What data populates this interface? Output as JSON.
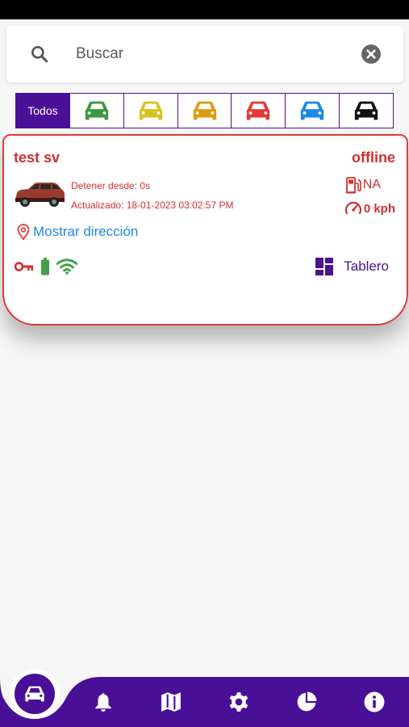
{
  "search": {
    "placeholder": "Buscar"
  },
  "filters": {
    "all_label": "Todos",
    "colors": [
      "#3a9a3e",
      "#d7c41f",
      "#e09a10",
      "#e53935",
      "#1e88e5",
      "#111111"
    ]
  },
  "vehicle": {
    "name": "test sv",
    "status": "offline",
    "stop_since": "Detener desde: 0s",
    "updated": "Actualizado: 18-01-2023 03:02:57 PM",
    "fuel": "NA",
    "speed": "0 kph",
    "address_link": "Mostrar dirección",
    "dashboard_label": "Tablero"
  },
  "colors": {
    "primary": "#4a0f97",
    "alert": "#d32f2f",
    "link": "#1e88e5",
    "ok": "#43a047"
  },
  "nav": {
    "items": [
      "car-icon",
      "bell-icon",
      "map-icon",
      "gear-icon",
      "pie-chart-icon",
      "info-icon"
    ]
  }
}
